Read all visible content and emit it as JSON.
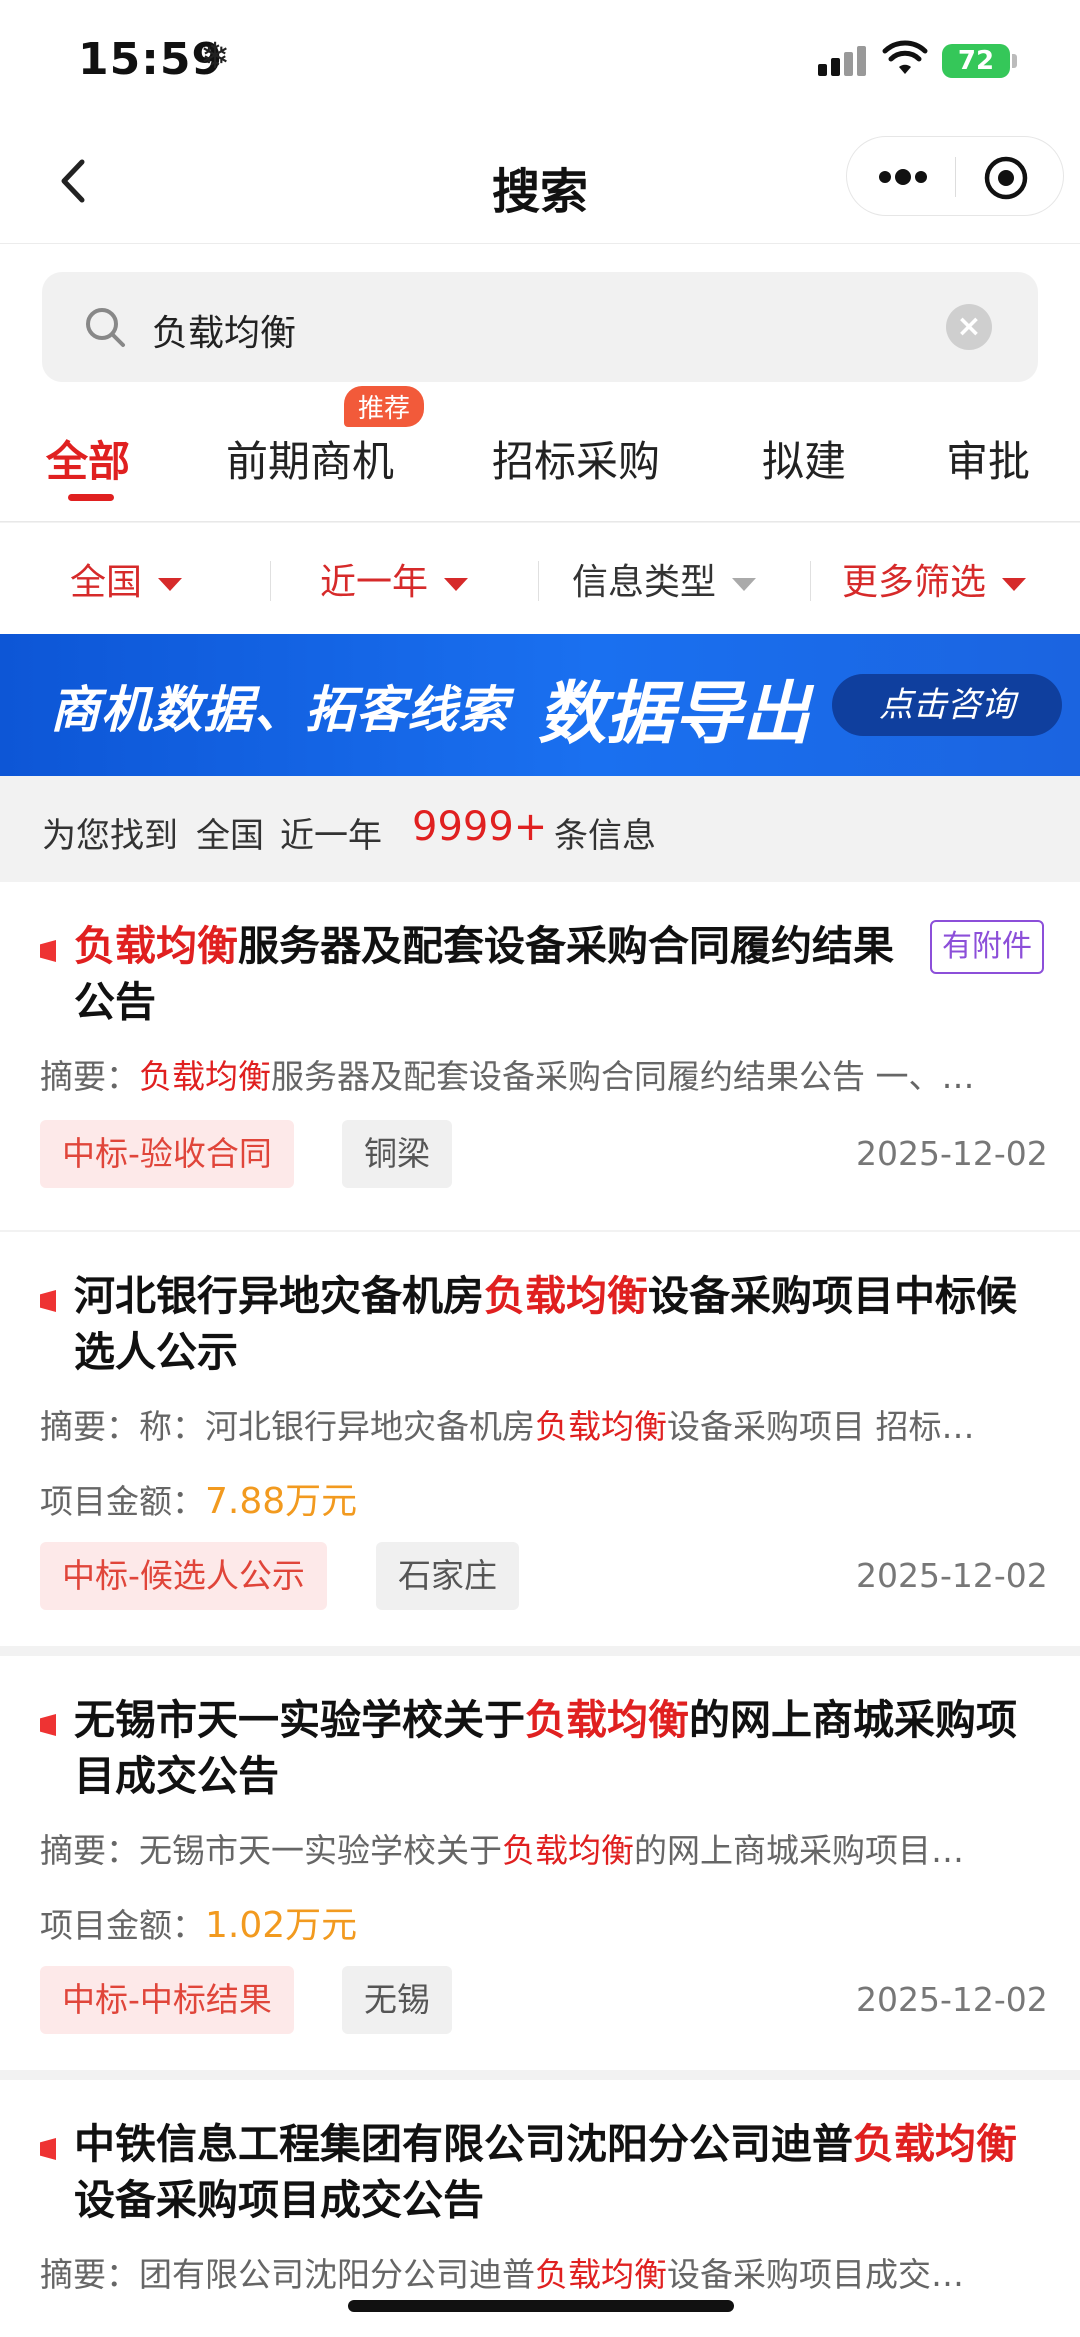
{
  "status_bar": {
    "time": "15:59",
    "battery": "72"
  },
  "nav": {
    "title": "搜索"
  },
  "search": {
    "value": "负载均衡"
  },
  "tabs": [
    {
      "label": "全部",
      "active": true
    },
    {
      "label": "前期商机",
      "badge": "推荐"
    },
    {
      "label": "招标采购"
    },
    {
      "label": "拟建"
    },
    {
      "label": "审批"
    }
  ],
  "filters": [
    {
      "label": "全国"
    },
    {
      "label": "近一年"
    },
    {
      "label": "信息类型"
    },
    {
      "label": "更多筛选"
    }
  ],
  "banner": {
    "text": "商机数据、拓客线索",
    "highlight": "数据导出",
    "button": "点击咨询"
  },
  "result_count": {
    "prefix": "为您找到",
    "region": "全国",
    "period": "近一年",
    "count": "9999+",
    "suffix": "条信息"
  },
  "results": [
    {
      "title_pre": "",
      "title_hl": "负载均衡",
      "title_post": "服务器及配套设备采购合同履约结果公告",
      "attachment": "有附件",
      "summary_label": "摘要：",
      "summary_pre": "",
      "summary_hl": "负载均衡",
      "summary_post": "服务器及配套设备采购合同履约结果公告 一、…",
      "tag": "中标-验收合同",
      "region": "铜梁",
      "date": "2025-12-02"
    },
    {
      "title_pre": "河北银行异地灾备机房",
      "title_hl": "负载均衡",
      "title_post": "设备采购项目中标候选人公示",
      "summary_label": "摘要：",
      "summary_pre": "称：河北银行异地灾备机房",
      "summary_hl": "负载均衡",
      "summary_post": "设备采购项目 招标…",
      "amount_label": "项目金额：",
      "amount": "7.88万元",
      "tag": "中标-候选人公示",
      "region": "石家庄",
      "date": "2025-12-02"
    },
    {
      "title_pre": "无锡市天一实验学校关于",
      "title_hl": "负载均衡",
      "title_post": "的网上商城采购项目成交公告",
      "summary_label": "摘要：",
      "summary_pre": "无锡市天一实验学校关于",
      "summary_hl": "负载均衡",
      "summary_post": "的网上商城采购项目…",
      "amount_label": "项目金额：",
      "amount": "1.02万元",
      "tag": "中标-中标结果",
      "region": "无锡",
      "date": "2025-12-02"
    },
    {
      "title_pre": "中铁信息工程集团有限公司沈阳分公司迪普",
      "title_hl": "负载均衡",
      "title_post": "设备采购项目成交公告",
      "summary_label": "摘要：",
      "summary_pre": "团有限公司沈阳分公司迪普",
      "summary_hl": "负载均衡",
      "summary_post": "设备采购项目成交…"
    }
  ]
}
